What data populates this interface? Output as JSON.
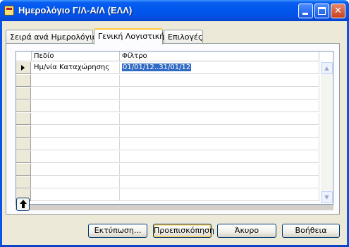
{
  "window": {
    "title": "Ημερολόγιο Γ/Λ-Α/Λ (ΕΛΛ)",
    "minimize_icon": "minimize-icon",
    "maximize_icon": "maximize-icon",
    "close_icon": "close-icon",
    "close_glyph": "✕"
  },
  "tabs": [
    {
      "label": "Σειρά ανά Ημερολόγια",
      "active": false
    },
    {
      "label": "Γενική Λογιστική",
      "active": true
    },
    {
      "label": "Επιλογές",
      "active": false
    }
  ],
  "filter_grid": {
    "headers": {
      "field": "Πεδίο",
      "filter": "Φίλτρο"
    },
    "rows": [
      {
        "field": "Ημ/νία Καταχώρησης",
        "filter": "01/01/12..31/01/12",
        "current": true
      },
      {
        "field": "",
        "filter": ""
      },
      {
        "field": "",
        "filter": ""
      },
      {
        "field": "",
        "filter": ""
      },
      {
        "field": "",
        "filter": ""
      },
      {
        "field": "",
        "filter": ""
      },
      {
        "field": "",
        "filter": ""
      },
      {
        "field": "",
        "filter": ""
      },
      {
        "field": "",
        "filter": ""
      },
      {
        "field": "",
        "filter": ""
      },
      {
        "field": "",
        "filter": ""
      }
    ],
    "scroll_up_glyph": "▲",
    "scroll_down_glyph": "▼"
  },
  "buttons": {
    "print": "Εκτύπωση...",
    "preview": "Προεπισκόπηση",
    "cancel": "Άκυρο",
    "help": "Βοήθεια"
  },
  "colors": {
    "titlebar": "#0058ee",
    "selection": "#316ac5",
    "dialog_face": "#ece9d8"
  }
}
